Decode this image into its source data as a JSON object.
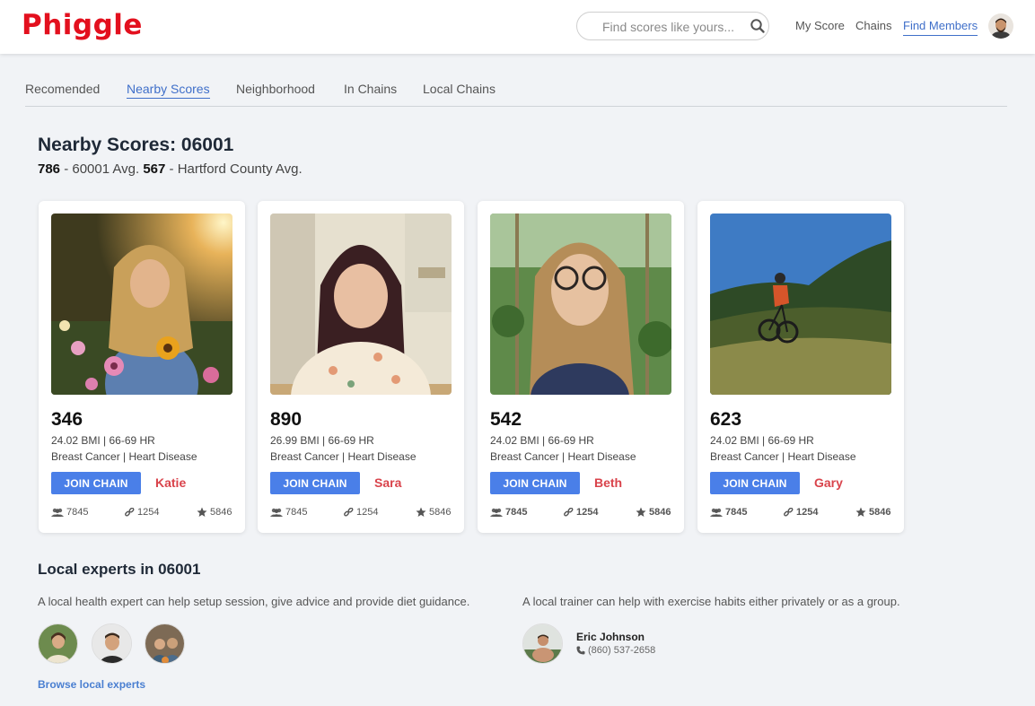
{
  "header": {
    "logo": "Phiggle",
    "search_placeholder": "Find scores like yours...",
    "nav": [
      {
        "label": "My Score",
        "active": false
      },
      {
        "label": "Chains",
        "active": false
      },
      {
        "label": "Find Members",
        "active": true
      }
    ],
    "search_icon": "search-icon",
    "avatar_icon": "user-avatar"
  },
  "tabs": [
    {
      "label": "Recomended",
      "active": false
    },
    {
      "label": "Nearby Scores",
      "active": true
    },
    {
      "label": "Neighborhood",
      "active": false
    },
    {
      "label": "In Chains",
      "active": false
    },
    {
      "label": "Local Chains",
      "active": false
    }
  ],
  "page": {
    "title": "Nearby Scores: 06001",
    "subtitle": {
      "zip_avg_value": "786",
      "zip_avg_label": " - 60001 Avg. ",
      "county_avg_value": "567",
      "county_avg_label": " - Hartford County Avg."
    }
  },
  "cards": [
    {
      "score": "346",
      "metrics": "24.02 BMI | 66-69 HR",
      "conditions": "Breast Cancer | Heart Disease",
      "button": "JOIN CHAIN",
      "name": "Katie",
      "members": "7845",
      "links": "1254",
      "stars": "5846",
      "stats_bold": false
    },
    {
      "score": "890",
      "metrics": "26.99 BMI | 66-69 HR",
      "conditions": "Breast Cancer | Heart Disease",
      "button": "JOIN CHAIN",
      "name": "Sara",
      "members": "7845",
      "links": "1254",
      "stars": "5846",
      "stats_bold": false
    },
    {
      "score": "542",
      "metrics": "24.02 BMI | 66-69 HR",
      "conditions": "Breast Cancer | Heart Disease",
      "button": "JOIN CHAIN",
      "name": "Beth",
      "members": "7845",
      "links": "1254",
      "stars": "5846",
      "stats_bold": true
    },
    {
      "score": "623",
      "metrics": "24.02 BMI | 66-69 HR",
      "conditions": "Breast Cancer | Heart Disease",
      "button": "JOIN CHAIN",
      "name": "Gary",
      "members": "7845",
      "links": "1254",
      "stars": "5846",
      "stats_bold": true
    }
  ],
  "experts": {
    "title": "Local experts in 06001",
    "health_desc": "A local health expert can help setup session, give advice and provide diet guidance.",
    "trainer_desc": "A local trainer can help with exercise habits either privately or as a group.",
    "browse_label": "Browse local experts",
    "trainer_name": "Eric Johnson",
    "trainer_phone": "(860) 537-2658"
  },
  "colors": {
    "brand": "#e3101e",
    "accent": "#3f6fc9",
    "button": "#4a7fe8",
    "name": "#d9434b"
  }
}
